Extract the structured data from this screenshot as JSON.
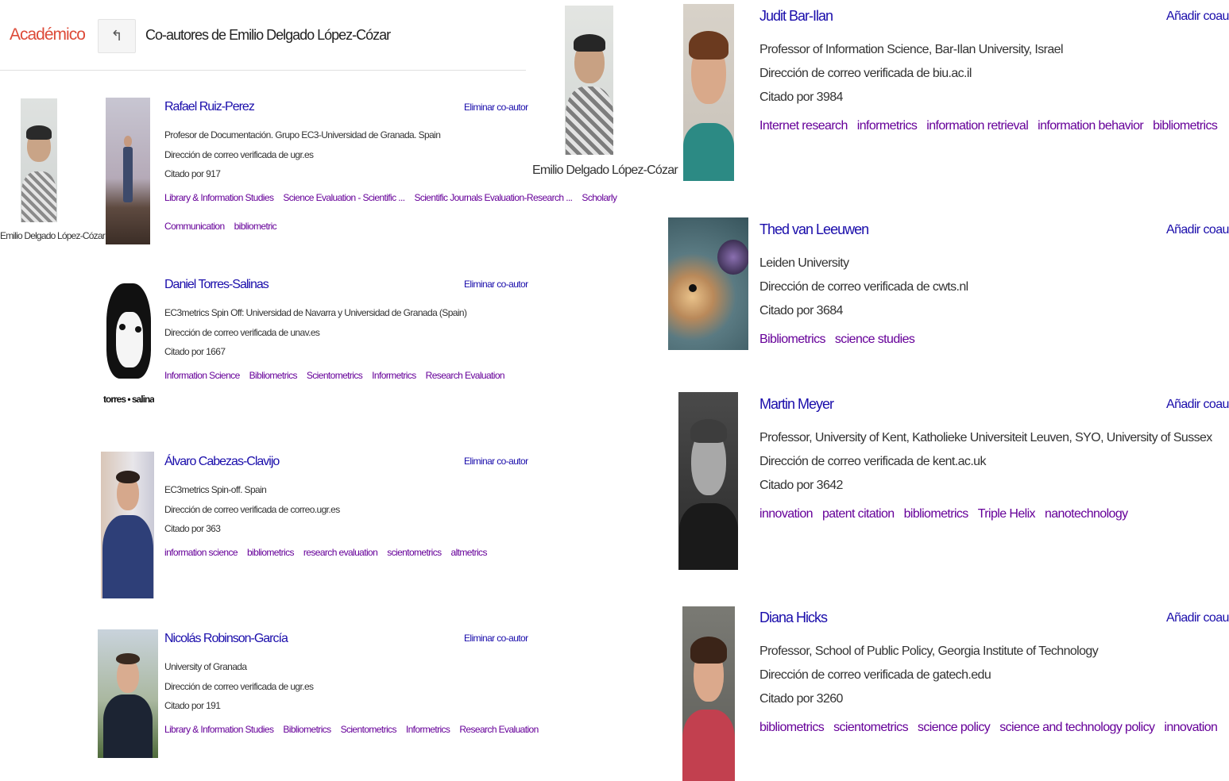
{
  "left_panel": {
    "brand": "Académico",
    "back_icon": "arrow-back-icon",
    "title": "Co-autores de Emilio Delgado López-Cózar",
    "owner_caption": "Emilio Delgado López-Cózar",
    "remove_label": "Eliminar co-autor",
    "coauthors": [
      {
        "name": "Rafael Ruiz-Perez",
        "affiliation": "Profesor de Documentación. Grupo EC3-Universidad de Granada. Spain",
        "email": "Dirección de correo verificada de ugr.es",
        "cited": "Citado por 917",
        "tags": [
          "Library & Information Studies",
          "Science Evaluation - Scientific ...",
          "Scientific Journals Evaluation-Research ...",
          "Scholarly"
        ],
        "tags2": [
          "Communication",
          "bibliometric"
        ]
      },
      {
        "name": "Daniel Torres-Salinas",
        "affiliation": "EC3metrics Spin Off: Universidad de Navarra y Universidad de Granada (Spain)",
        "email": "Dirección de correo verificada de unav.es",
        "cited": "Citado por 1667",
        "tags": [
          "Information Science",
          "Bibliometrics",
          "Scientometrics",
          "Informetrics",
          "Research Evaluation"
        ],
        "photo_text": "torres • salinas"
      },
      {
        "name": "Álvaro Cabezas-Clavijo",
        "affiliation": "EC3metrics Spin-off. Spain",
        "email": "Dirección de correo verificada de correo.ugr.es",
        "cited": "Citado por 363",
        "tags": [
          "information science",
          "bibliometrics",
          "research evaluation",
          "scientometrics",
          "altmetrics"
        ]
      },
      {
        "name": "Nicolás Robinson-García",
        "affiliation": "University of Granada",
        "email": "Dirección de correo verificada de ugr.es",
        "cited": "Citado por 191",
        "tags": [
          "Library & Information Studies",
          "Bibliometrics",
          "Scientometrics",
          "Informetrics",
          "Research Evaluation"
        ]
      }
    ]
  },
  "right_panel": {
    "owner_caption": "Emilio Delgado López-Cózar",
    "add_label": "Añadir coautor",
    "suggestions": [
      {
        "name": "Judit Bar-Ilan",
        "affiliation": "Professor of Information Science, Bar-Ilan University, Israel",
        "email": "Dirección de correo verificada de biu.ac.il",
        "cited": "Citado por 3984",
        "tags": [
          "Internet research",
          "informetrics",
          "information retrieval",
          "information behavior",
          "bibliometrics"
        ]
      },
      {
        "name": "Thed van Leeuwen",
        "affiliation": "Leiden University",
        "email": "Dirección de correo verificada de cwts.nl",
        "cited": "Citado por 3684",
        "tags": [
          "Bibliometrics",
          "science studies"
        ]
      },
      {
        "name": "Martin Meyer",
        "affiliation": "Professor, University of Kent, Katholieke Universiteit Leuven, SYO, University of Sussex",
        "email": "Dirección de correo verificada de kent.ac.uk",
        "cited": "Citado por 3642",
        "tags": [
          "innovation",
          "patent citation",
          "bibliometrics",
          "Triple Helix",
          "nanotechnology"
        ]
      },
      {
        "name": "Diana Hicks",
        "affiliation": "Professor, School of Public Policy, Georgia Institute of Technology",
        "email": "Dirección de correo verificada de gatech.edu",
        "cited": "Citado por 3260",
        "tags": [
          "bibliometrics",
          "scientometrics",
          "science policy",
          "science and technology policy",
          "innovation"
        ]
      }
    ]
  }
}
